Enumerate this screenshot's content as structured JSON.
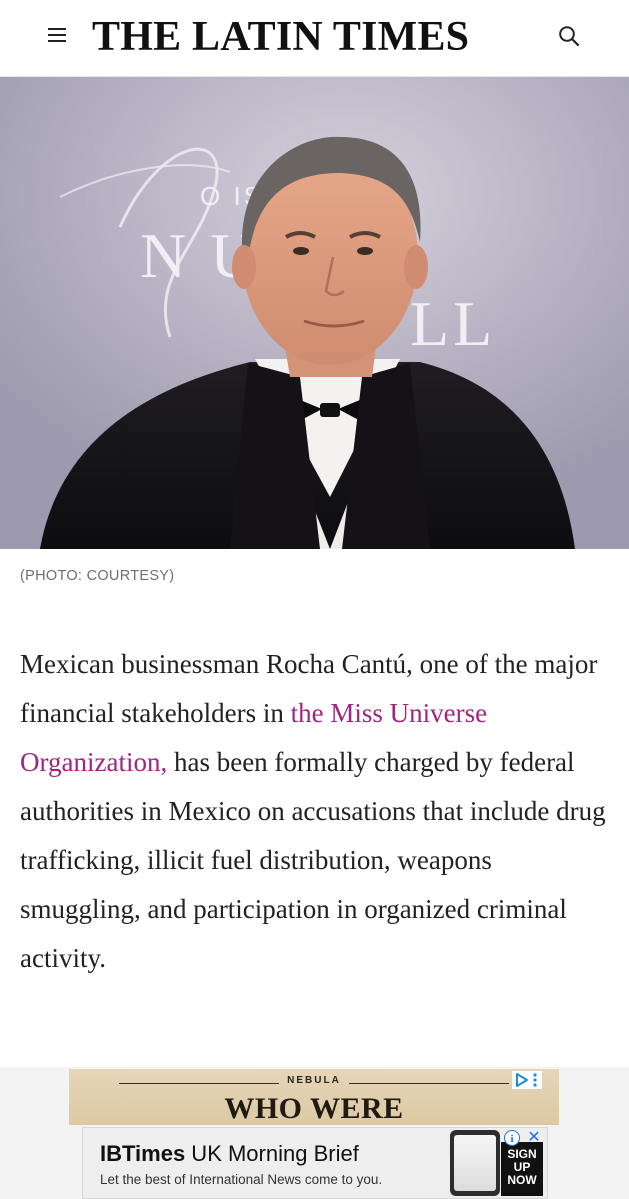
{
  "header": {
    "logo": "THE LATIN TIMES",
    "menu_icon": "hamburger-menu-icon",
    "search_icon": "search-icon"
  },
  "hero": {
    "backdrop_text_line1": "O    ISPANIC",
    "backdrop_text_line2": "N   URAL",
    "backdrop_text_line3": "LL",
    "caption": "(PHOTO: COURTESY)"
  },
  "article": {
    "text_before_link": "Mexican businessman Rocha Cantú, one of the major financial stakeholders in ",
    "link_text": "the Miss Universe Organization,",
    "text_after_link": " has been formally charged by federal authorities in Mexico on accusations that include drug trafficking, illicit fuel distribution, weapons smuggling, and participation in organized criminal activity.",
    "link_color": "#a3247e"
  },
  "ads": {
    "top": {
      "kicker": "NEBULA",
      "headline": "WHO WERE",
      "choices_icon": "adchoices-icon"
    },
    "bottom": {
      "brand_bold": "IBTimes",
      "brand_rest": " UK Morning Brief",
      "tagline": "Let the best of International News come to you.",
      "cta_line1": "SIGN",
      "cta_line2": "UP",
      "cta_line3": "NOW",
      "info_icon": "info-icon",
      "close_icon": "close-icon"
    }
  }
}
